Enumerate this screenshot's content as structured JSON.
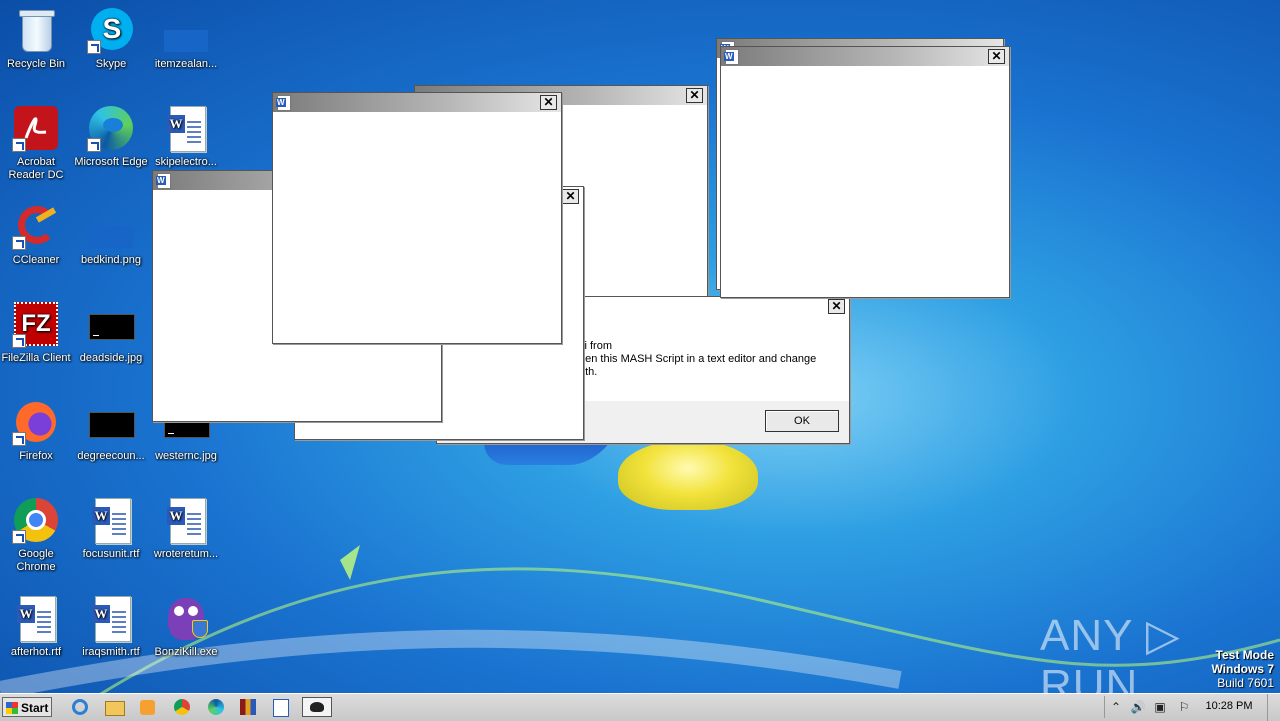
{
  "desktop_icons": [
    {
      "label": "Recycle Bin"
    },
    {
      "label": "Skype"
    },
    {
      "label": "itemzealan..."
    },
    {
      "label": "Acrobat Reader DC"
    },
    {
      "label": "Microsoft Edge"
    },
    {
      "label": "skipelectro..."
    },
    {
      "label": "CCleaner"
    },
    {
      "label": "bedkind.png"
    },
    {
      "label": "FileZilla Client"
    },
    {
      "label": "deadside.jpg"
    },
    {
      "label": "Firefox"
    },
    {
      "label": "degreecoun..."
    },
    {
      "label": "westernc.jpg"
    },
    {
      "label": "Google Chrome"
    },
    {
      "label": "focusunit.rtf"
    },
    {
      "label": "wroteretum..."
    },
    {
      "label": "afterhot.rtf"
    },
    {
      "label": "iraqsmith.rtf"
    },
    {
      "label": "BonziKill.exe"
    }
  ],
  "dialog": {
    "text_line1": "ci from",
    "text_line2": "pen this MASH Script in a text editor and change",
    "text_line3": "ath.",
    "ok_label": "OK"
  },
  "window_close_glyph": "✕",
  "watermark": "ANY ▷ RUN",
  "test_mode": {
    "line1": "Test Mode",
    "line2": "Windows 7",
    "line3": "Build 7601"
  },
  "taskbar": {
    "start_label": "Start",
    "clock": "10:28 PM",
    "tray_up": "⌃",
    "tray_volume": "🔊",
    "tray_network": "▣",
    "tray_flag": "⚐"
  }
}
